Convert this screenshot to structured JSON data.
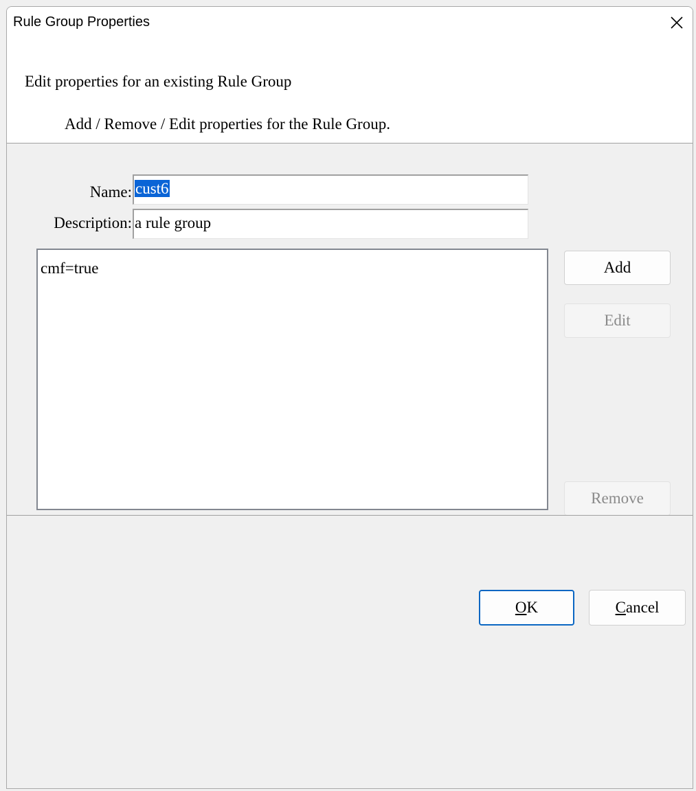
{
  "window": {
    "title": "Rule Group Properties",
    "close_icon": "close-icon"
  },
  "header": {
    "title": "Edit properties for an existing Rule Group",
    "subtitle": "Add / Remove / Edit properties for the Rule Group."
  },
  "form": {
    "name_label": "Name:",
    "name_value": "cust6",
    "description_label": "Description:",
    "description_value": "a rule group"
  },
  "properties": {
    "items": [
      "cmf=true"
    ]
  },
  "side_buttons": {
    "add": "Add",
    "edit": "Edit",
    "remove": "Remove"
  },
  "footer": {
    "ok_mnemonic": "O",
    "ok_rest": "K",
    "cancel_mnemonic": "C",
    "cancel_rest": "ancel"
  },
  "colors": {
    "selection": "#0a64d6",
    "default_button_border": "#0a66c2"
  }
}
